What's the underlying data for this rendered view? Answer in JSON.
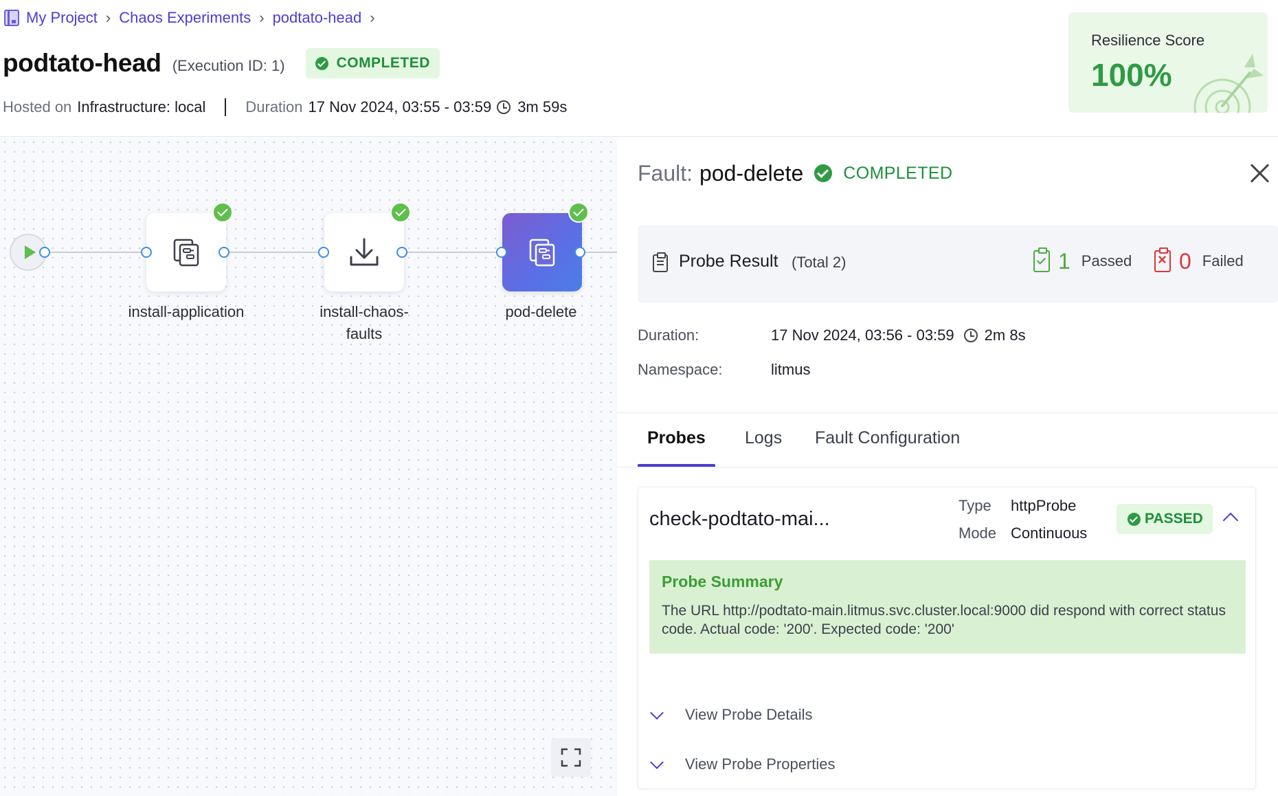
{
  "breadcrumb": {
    "items": [
      "My Project",
      "Chaos Experiments",
      "podtato-head"
    ]
  },
  "header": {
    "title": "podtato-head",
    "execution_id": "(Execution ID: 1)",
    "status": "COMPLETED",
    "hosted_label": "Hosted on",
    "hosted_value": "Infrastructure: local",
    "duration_label": "Duration",
    "duration_range": "17 Nov 2024, 03:55 - 03:59",
    "duration_total": "3m 59s"
  },
  "resilience": {
    "label": "Resilience Score",
    "value": "100%"
  },
  "canvas": {
    "nodes": [
      {
        "label": "install-application",
        "icon": "workflow-icon",
        "completed": true
      },
      {
        "label": "install-chaos-faults",
        "icon": "download-icon",
        "completed": true
      },
      {
        "label": "pod-delete",
        "icon": "workflow-icon",
        "completed": true,
        "active": true
      }
    ],
    "node_label_lines": {
      "n2_line1": "install-chaos-",
      "n2_line2": "faults"
    }
  },
  "panel": {
    "fault_prefix": "Fault:",
    "fault_name": "pod-delete",
    "fault_status": "COMPLETED",
    "probe_result": {
      "title": "Probe Result",
      "total": "(Total 2)",
      "passed_count": "1",
      "passed_label": "Passed",
      "failed_count": "0",
      "failed_label": "Failed"
    },
    "details": {
      "duration_label": "Duration:",
      "duration_range": "17 Nov 2024, 03:56 - 03:59",
      "duration_total": "2m 8s",
      "namespace_label": "Namespace:",
      "namespace_value": "litmus"
    },
    "tabs": [
      {
        "label": "Probes",
        "active": true
      },
      {
        "label": "Logs",
        "active": false
      },
      {
        "label": "Fault Configuration",
        "active": false
      }
    ],
    "probe": {
      "name": "check-podtato-mai...",
      "type_label": "Type",
      "type_value": "httpProbe",
      "mode_label": "Mode",
      "mode_value": "Continuous",
      "status": "PASSED",
      "summary_title": "Probe Summary",
      "summary_text": "The URL http://podtato-main.litmus.svc.cluster.local:9000 did respond with correct status code. Actual code: '200'. Expected code: '200'",
      "view_details": "View Probe Details",
      "view_properties": "View Probe Properties"
    }
  },
  "colors": {
    "accent": "#4a3ed1",
    "success": "#2f9a44",
    "failure": "#d9373a",
    "success_bg": "#e4f7e1"
  }
}
